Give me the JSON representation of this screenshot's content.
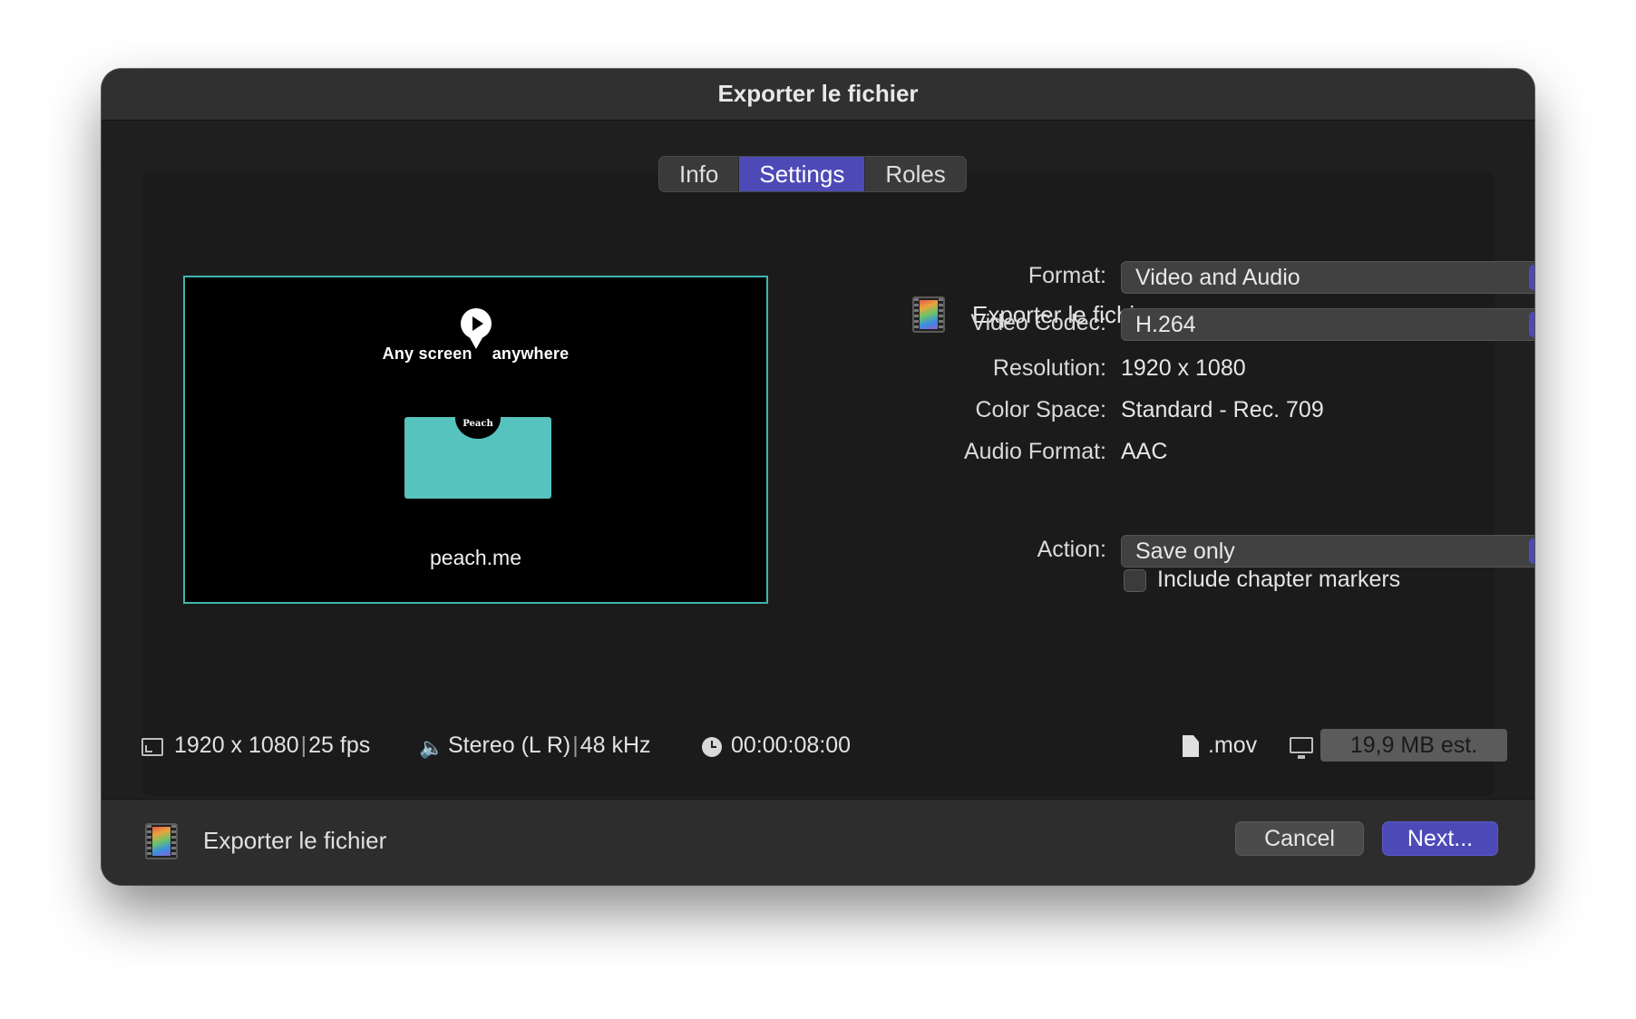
{
  "window": {
    "title": "Exporter le fichier"
  },
  "tabs": [
    {
      "label": "Info",
      "active": false
    },
    {
      "label": "Settings",
      "active": true
    },
    {
      "label": "Roles",
      "active": false
    }
  ],
  "preview": {
    "tagline_left": "Any screen",
    "tagline_right": "anywhere",
    "badge_text": "Peach",
    "site": "peach.me"
  },
  "destination": {
    "icon": "film-icon",
    "name": "Exporter le fichier"
  },
  "settings": {
    "format": {
      "label": "Format:",
      "value": "Video and Audio"
    },
    "video_codec": {
      "label": "Video Codec:",
      "value": "H.264"
    },
    "resolution": {
      "label": "Resolution:",
      "value": "1920 x 1080"
    },
    "color_space": {
      "label": "Color Space:",
      "value": "Standard - Rec. 709"
    },
    "audio_format": {
      "label": "Audio Format:",
      "value": "AAC"
    },
    "chapter_markers": {
      "label": "Include chapter markers",
      "checked": false
    },
    "action": {
      "label": "Action:",
      "value": "Save only"
    }
  },
  "infobar": {
    "resolution": "1920 x 1080",
    "fps": "25 fps",
    "audio_channels": "Stereo (L R)",
    "sample_rate": "48 kHz",
    "duration": "00:00:08:00",
    "extension": ".mov",
    "size": "19,9 MB est."
  },
  "footer": {
    "label": "Exporter le fichier",
    "cancel": "Cancel",
    "next": "Next..."
  },
  "colors": {
    "accent": "#4d4ab8",
    "preview_border": "#3fb6b0",
    "peach_card": "#56c3be"
  }
}
